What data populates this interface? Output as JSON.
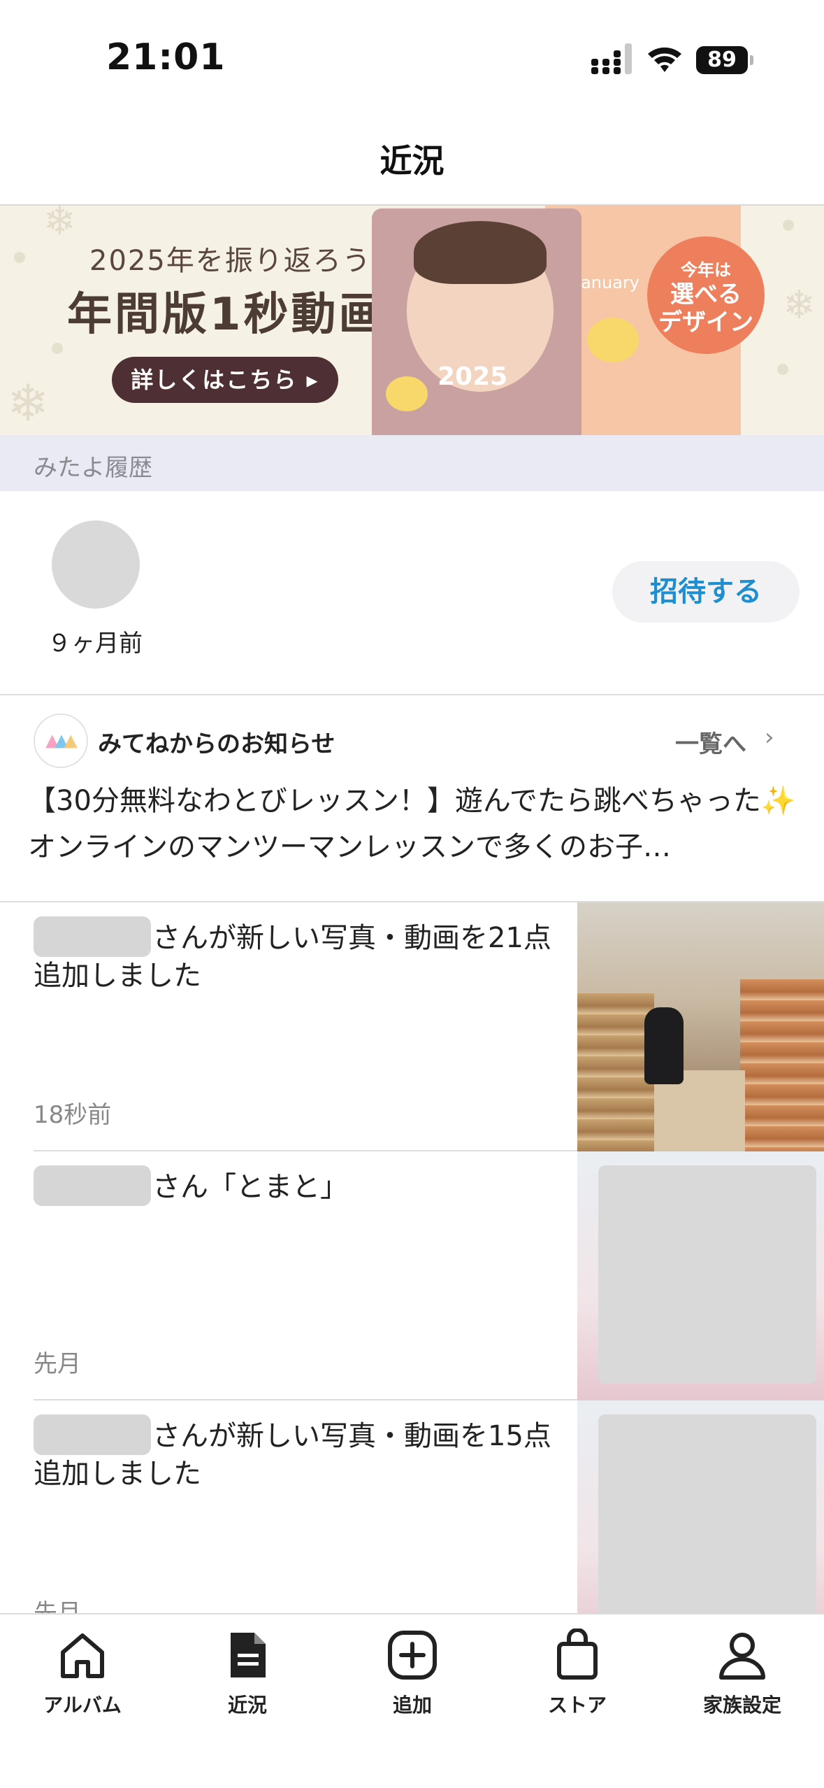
{
  "status_bar": {
    "time": "21:01",
    "battery": "89"
  },
  "nav": {
    "title": "近況"
  },
  "banner": {
    "subtitle": "2025年を振り返ろう",
    "title": "年間版1秒動画",
    "button": "詳しくはこちら ▸",
    "card_text": "2025",
    "card_label": "January",
    "badge_line1": "今年は",
    "badge_line2": "選べる",
    "badge_line3": "デザイン"
  },
  "history": {
    "header": "みたよ履歴",
    "time": "９ヶ月前",
    "invite_button": "招待する"
  },
  "news": {
    "title": "みてねからのお知らせ",
    "link": "一覧へ",
    "body": "【30分無料なわとびレッスン！】遊んでたら跳べちゃった✨ オンラインのマンツーマンレッスンで多くのお子…"
  },
  "feed": [
    {
      "text": "さんが新しい写真・動画を21点追加しました",
      "time": "18秒前"
    },
    {
      "text": "さん「とまと」",
      "time": "先月"
    },
    {
      "text": "さんが新しい写真・動画を15点追加しました",
      "time": "先月"
    }
  ],
  "tabs": [
    {
      "label": "アルバム",
      "icon": "home-icon"
    },
    {
      "label": "近況",
      "icon": "document-icon"
    },
    {
      "label": "追加",
      "icon": "plus-square-icon"
    },
    {
      "label": "ストア",
      "icon": "shopping-bag-icon"
    },
    {
      "label": "家族設定",
      "icon": "person-icon"
    }
  ],
  "colors": {
    "accent": "#1e8ed0",
    "banner_bg": "#f5f1e4",
    "badge": "#ee7f5d"
  }
}
